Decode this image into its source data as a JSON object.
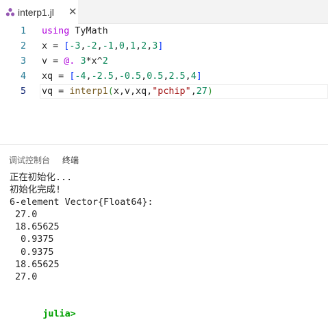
{
  "tab": {
    "title": "interp1.jl",
    "close_glyph": "✕",
    "icon": "julia-dots-icon"
  },
  "colors": {
    "keyword": "#af00db",
    "number": "#098658",
    "string": "#a31515",
    "function": "#795e26",
    "bracket": "#0431fa",
    "paren": "#319331",
    "line_number": "#237893",
    "prompt": "#00a000"
  },
  "editor": {
    "lines": [
      {
        "number": "1",
        "tokens": [
          {
            "t": "kw",
            "v": "using"
          },
          {
            "t": "txt",
            "v": " TyMath"
          }
        ]
      },
      {
        "number": "2",
        "tokens": [
          {
            "t": "txt",
            "v": "x = "
          },
          {
            "t": "br1",
            "v": "["
          },
          {
            "t": "num",
            "v": "-3"
          },
          {
            "t": "txt",
            "v": ","
          },
          {
            "t": "num",
            "v": "-2"
          },
          {
            "t": "txt",
            "v": ","
          },
          {
            "t": "num",
            "v": "-1"
          },
          {
            "t": "txt",
            "v": ","
          },
          {
            "t": "num",
            "v": "0"
          },
          {
            "t": "txt",
            "v": ","
          },
          {
            "t": "num",
            "v": "1"
          },
          {
            "t": "txt",
            "v": ","
          },
          {
            "t": "num",
            "v": "2"
          },
          {
            "t": "txt",
            "v": ","
          },
          {
            "t": "num",
            "v": "3"
          },
          {
            "t": "br1",
            "v": "]"
          }
        ]
      },
      {
        "number": "3",
        "tokens": [
          {
            "t": "txt",
            "v": "v = "
          },
          {
            "t": "kw",
            "v": "@."
          },
          {
            "t": "txt",
            "v": " "
          },
          {
            "t": "num",
            "v": "3"
          },
          {
            "t": "txt",
            "v": "*x^"
          },
          {
            "t": "num",
            "v": "2"
          }
        ]
      },
      {
        "number": "4",
        "tokens": [
          {
            "t": "txt",
            "v": "xq = "
          },
          {
            "t": "br1",
            "v": "["
          },
          {
            "t": "num",
            "v": "-4"
          },
          {
            "t": "txt",
            "v": ","
          },
          {
            "t": "num",
            "v": "-2.5"
          },
          {
            "t": "txt",
            "v": ","
          },
          {
            "t": "num",
            "v": "-0.5"
          },
          {
            "t": "txt",
            "v": ","
          },
          {
            "t": "num",
            "v": "0.5"
          },
          {
            "t": "txt",
            "v": ","
          },
          {
            "t": "num",
            "v": "2.5"
          },
          {
            "t": "txt",
            "v": ","
          },
          {
            "t": "num",
            "v": "4"
          },
          {
            "t": "br1",
            "v": "]"
          }
        ]
      },
      {
        "number": "5",
        "tokens": [
          {
            "t": "txt",
            "v": "vq = "
          },
          {
            "t": "fn",
            "v": "interp1"
          },
          {
            "t": "br2",
            "v": "("
          },
          {
            "t": "txt",
            "v": "x,v,xq,"
          },
          {
            "t": "str",
            "v": "\"pchip\""
          },
          {
            "t": "txt",
            "v": ","
          },
          {
            "t": "num",
            "v": "27"
          },
          {
            "t": "br2",
            "v": ")"
          }
        ]
      }
    ]
  },
  "panel": {
    "tabs": [
      {
        "label": "调试控制台",
        "active": false
      },
      {
        "label": "终端",
        "active": true
      }
    ],
    "terminal_lines": [
      "正在初始化...",
      "初始化完成!",
      "6-element Vector{Float64}:",
      " 27.0",
      " 18.65625",
      "  0.9375",
      "  0.9375",
      " 18.65625",
      " 27.0",
      ""
    ],
    "prompt": "julia>"
  }
}
